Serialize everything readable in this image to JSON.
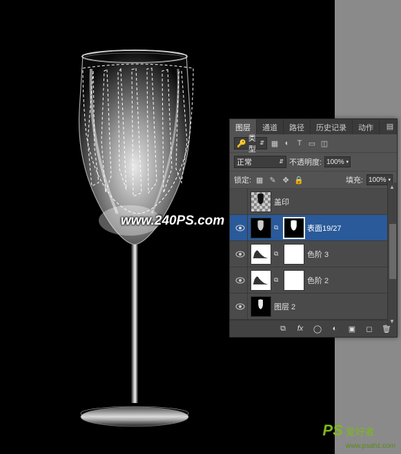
{
  "watermarks": {
    "center": "www.240PS.com",
    "bottom_right_ps": "PS",
    "bottom_right_text": "爱好者",
    "bottom_right_url": "www.psahz.com"
  },
  "panel": {
    "tabs": [
      "图层",
      "通道",
      "路径",
      "历史记录",
      "动作"
    ],
    "active_tab": 0,
    "filter_label": "类型",
    "blend_mode": "正常",
    "opacity_label": "不透明度:",
    "opacity_value": "100%",
    "lock_label": "锁定:",
    "fill_label": "填充:",
    "fill_value": "100%"
  },
  "layers": [
    {
      "visible": false,
      "name": "盖印",
      "kind": "image",
      "bg": "checker",
      "mask": false,
      "selected": false
    },
    {
      "visible": true,
      "name": "表面19/27",
      "kind": "glass",
      "bg": "black",
      "mask": true,
      "selected": true
    },
    {
      "visible": true,
      "name": "色阶 3",
      "kind": "levels",
      "bg": "white",
      "mask": true,
      "selected": false
    },
    {
      "visible": true,
      "name": "色阶 2",
      "kind": "levels",
      "bg": "white",
      "mask": true,
      "selected": false
    },
    {
      "visible": true,
      "name": "图层 2",
      "kind": "image-glass",
      "bg": "black",
      "mask": false,
      "selected": false
    }
  ],
  "footer_icons": [
    "link",
    "fx",
    "mask",
    "adjust",
    "group",
    "new",
    "trash"
  ]
}
